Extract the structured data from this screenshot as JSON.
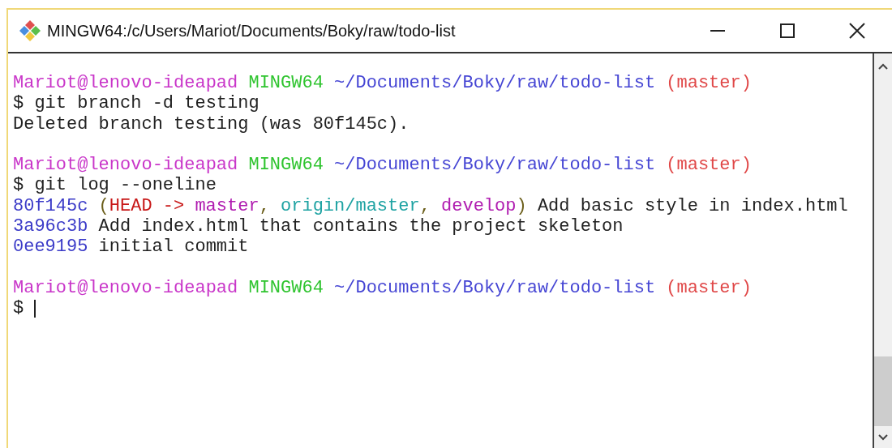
{
  "window": {
    "title": "MINGW64:/c/Users/Mariot/Documents/Boky/raw/todo-list"
  },
  "terminal": {
    "lines": [
      {
        "kind": "text",
        "segments": [
          {
            "kind": "user",
            "text": "Mariot@lenovo-ideapad"
          },
          {
            "kind": "host",
            "text": "MINGW64",
            "spaced": true
          },
          {
            "kind": "path",
            "text": "~/Documents/Boky/raw/todo-list",
            "spaced": true
          },
          {
            "kind": "branch",
            "text": "(master)",
            "spaced": true
          }
        ]
      },
      {
        "kind": "text",
        "segments": [
          {
            "kind": "plain",
            "text": "$ git branch -d testing"
          }
        ]
      },
      {
        "kind": "text",
        "segments": [
          {
            "kind": "plain",
            "text": "Deleted branch testing (was 80f145c)."
          }
        ]
      },
      {
        "kind": "blank"
      },
      {
        "kind": "text",
        "segments": [
          {
            "kind": "user",
            "text": "Mariot@lenovo-ideapad"
          },
          {
            "kind": "host",
            "text": "MINGW64",
            "spaced": true
          },
          {
            "kind": "path",
            "text": "~/Documents/Boky/raw/todo-list",
            "spaced": true
          },
          {
            "kind": "branch",
            "text": "(master)",
            "spaced": true
          }
        ]
      },
      {
        "kind": "text",
        "segments": [
          {
            "kind": "plain",
            "text": "$ git log --oneline"
          }
        ]
      },
      {
        "kind": "text",
        "segments": [
          {
            "kind": "hash",
            "text": "80f145c"
          },
          {
            "kind": "punct",
            "text": "(",
            "spaced": true
          },
          {
            "kind": "head",
            "text": "HEAD ->"
          },
          {
            "kind": "local",
            "text": "master",
            "spaced": true
          },
          {
            "kind": "punct",
            "text": ","
          },
          {
            "kind": "remote",
            "text": "origin/master",
            "spaced": true
          },
          {
            "kind": "punct",
            "text": ","
          },
          {
            "kind": "local",
            "text": "develop",
            "spaced": true
          },
          {
            "kind": "punct",
            "text": ")"
          },
          {
            "kind": "plain",
            "text": "Add basic style in index.html",
            "spaced": true
          }
        ]
      },
      {
        "kind": "text",
        "segments": [
          {
            "kind": "hash",
            "text": "3a96c3b"
          },
          {
            "kind": "plain",
            "text": "Add index.html that contains the project skeleton",
            "spaced": true
          }
        ]
      },
      {
        "kind": "text",
        "segments": [
          {
            "kind": "hash",
            "text": "0ee9195"
          },
          {
            "kind": "plain",
            "text": "initial commit",
            "spaced": true
          }
        ]
      },
      {
        "kind": "blank"
      },
      {
        "kind": "text",
        "segments": [
          {
            "kind": "user",
            "text": "Mariot@lenovo-ideapad"
          },
          {
            "kind": "host",
            "text": "MINGW64",
            "spaced": true
          },
          {
            "kind": "path",
            "text": "~/Documents/Boky/raw/todo-list",
            "spaced": true
          },
          {
            "kind": "branch",
            "text": "(master)",
            "spaced": true
          }
        ]
      },
      {
        "kind": "text",
        "segments": [
          {
            "kind": "plain",
            "text": "$"
          },
          {
            "kind": "cursor",
            "spaced": true
          }
        ]
      }
    ]
  }
}
